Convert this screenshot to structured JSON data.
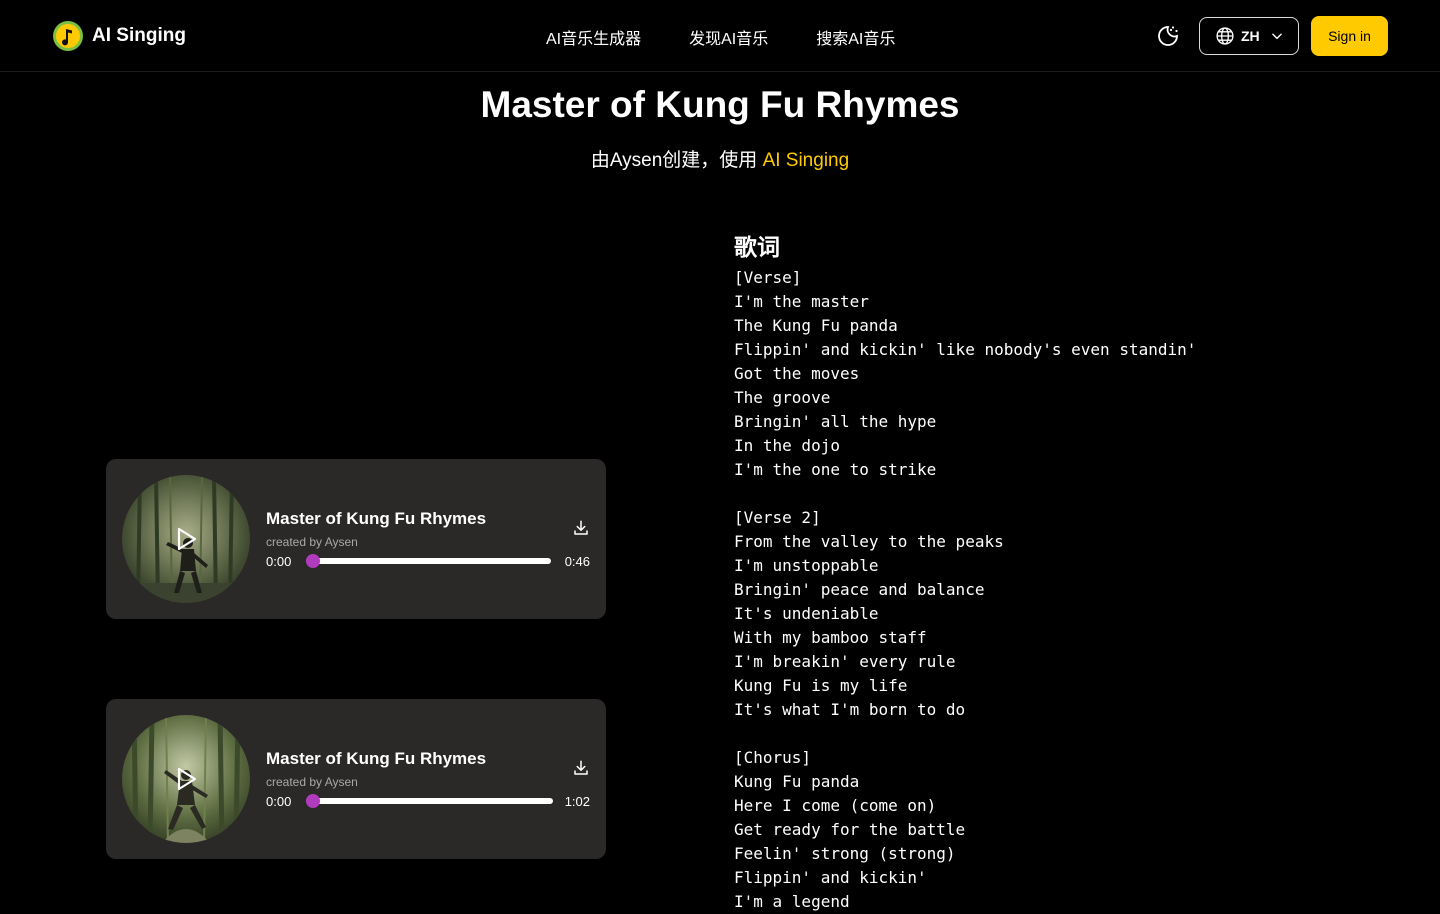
{
  "header": {
    "brand": "AI Singing",
    "nav": [
      "AI音乐生成器",
      "发现AI音乐",
      "搜索AI音乐"
    ],
    "language": "ZH",
    "sign_in": "Sign in",
    "accent_color": "#ffcb00"
  },
  "song": {
    "title": "Master of Kung Fu Rhymes",
    "subtitle_prefix": "由Aysen创建，使用 ",
    "subtitle_link": "AI Singing"
  },
  "players": [
    {
      "title": "Master of Kung Fu Rhymes",
      "creator": "created by Aysen",
      "current_time": "0:00",
      "duration": "0:46",
      "progress": 0
    },
    {
      "title": "Master of Kung Fu Rhymes",
      "creator": "created by Aysen",
      "current_time": "0:00",
      "duration": "1:02",
      "progress": 0
    }
  ],
  "lyrics": {
    "heading": "歌词",
    "text": "[Verse]\nI'm the master\nThe Kung Fu panda\nFlippin' and kickin' like nobody's even standin'\nGot the moves\nThe groove\nBringin' all the hype\nIn the dojo\nI'm the one to strike\n\n[Verse 2]\nFrom the valley to the peaks\nI'm unstoppable\nBringin' peace and balance\nIt's undeniable\nWith my bamboo staff\nI'm breakin' every rule\nKung Fu is my life\nIt's what I'm born to do\n\n[Chorus]\nKung Fu panda\nHere I come (come on)\nGet ready for the battle\nFeelin' strong (strong)\nFlippin' and kickin'\nI'm a legend"
  },
  "icons": {
    "logo": "music-note-logo-icon",
    "theme": "moon-icon",
    "language": "globe-icon",
    "dropdown": "chevron-down-icon",
    "play": "play-icon",
    "download": "download-icon"
  },
  "colors": {
    "background": "#000000",
    "card": "#2b2828",
    "progress_accent": "#b13bbd"
  }
}
